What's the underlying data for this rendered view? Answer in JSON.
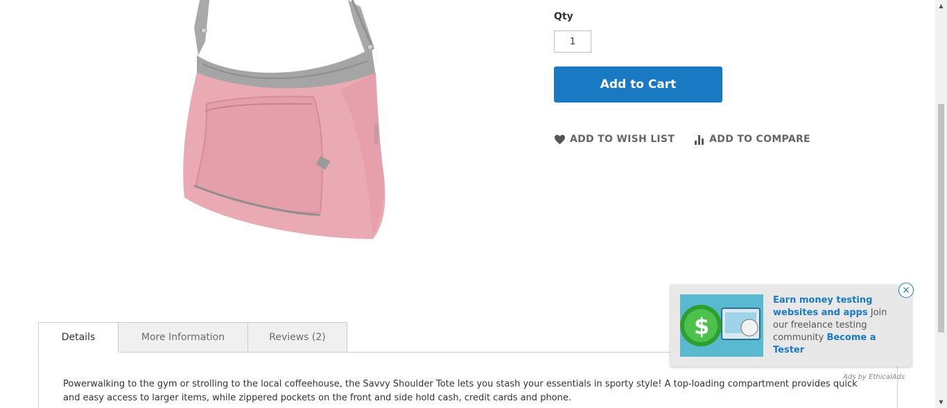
{
  "product": {
    "image_alt": "Savvy Shoulder Tote pink bag"
  },
  "qty": {
    "label": "Qty",
    "value": "1"
  },
  "cart": {
    "add_label": "Add to Cart"
  },
  "actions": {
    "wishlist_label": "Add to Wish List",
    "compare_label": "Add to Compare",
    "wishlist_icon": "heart-icon",
    "compare_icon": "bar-chart-icon"
  },
  "tabs": [
    {
      "label": "Details",
      "active": true
    },
    {
      "label": "More Information",
      "active": false
    },
    {
      "label": "Reviews (2)",
      "active": false
    }
  ],
  "details": {
    "description": "Powerwalking to the gym or strolling to the local coffeehouse, the Savvy Shoulder Tote lets you stash your essentials in sporty style! A top-loading compartment provides quick and easy access to larger items, while zippered pockets on the front and side hold cash, credit cards and phone."
  },
  "ad": {
    "headline": "Earn money testing websites and apps",
    "body": " Join our freelance testing community ",
    "cta": "Become a Tester",
    "attribution": "Ads by EthicalAds",
    "close_symbol": "×"
  },
  "colors": {
    "primary": "#1979c3",
    "text": "#333333",
    "muted": "#666666",
    "tab_bg": "#f0f0f0",
    "border": "#cccccc"
  }
}
